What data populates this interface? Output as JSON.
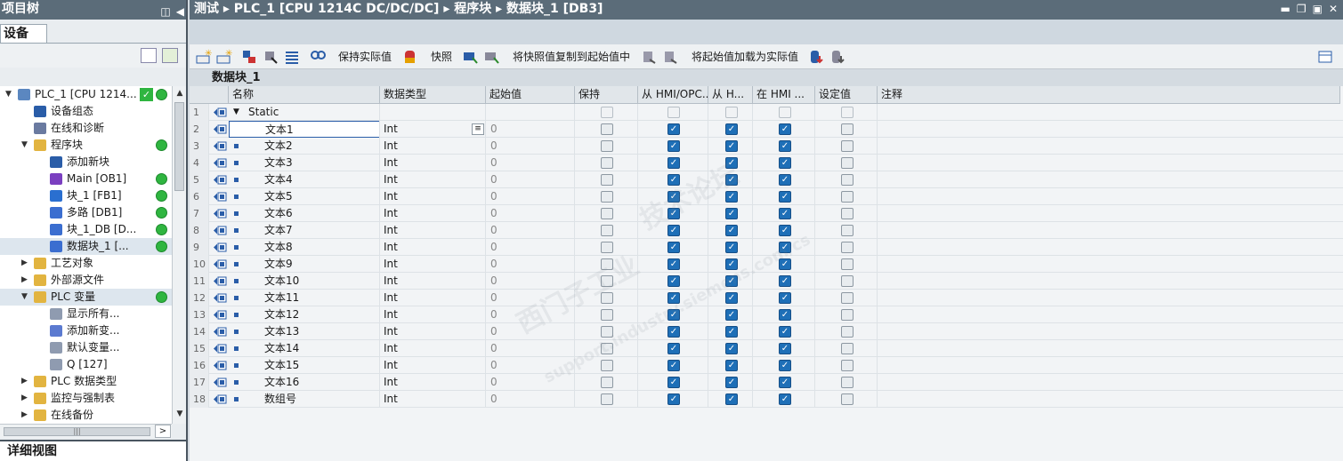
{
  "left_panel": {
    "title": "项目树",
    "tab": "设备",
    "detail_view": "详细视图",
    "tree": [
      {
        "label": "PLC_1 [CPU 1214...",
        "indent": 0,
        "expanded": true,
        "status": "check+green",
        "icon": "plc-icon"
      },
      {
        "label": "设备组态",
        "indent": 1,
        "icon": "device-config-icon"
      },
      {
        "label": "在线和诊断",
        "indent": 1,
        "icon": "online-diagnostics-icon"
      },
      {
        "label": "程序块",
        "indent": 1,
        "expanded": true,
        "status": "green",
        "icon": "folder-icon"
      },
      {
        "label": "添加新块",
        "indent": 2,
        "icon": "add-block-icon"
      },
      {
        "label": "Main [OB1]",
        "indent": 2,
        "status": "green",
        "icon": "ob-icon"
      },
      {
        "label": "块_1 [FB1]",
        "indent": 2,
        "status": "green",
        "icon": "fb-icon"
      },
      {
        "label": "多路 [DB1]",
        "indent": 2,
        "status": "green",
        "icon": "db-icon"
      },
      {
        "label": "块_1_DB [D...",
        "indent": 2,
        "status": "green",
        "icon": "db-icon"
      },
      {
        "label": "数据块_1 [...",
        "indent": 2,
        "status": "green",
        "icon": "db-icon",
        "selected": true
      },
      {
        "label": "工艺对象",
        "indent": 1,
        "collapsed": true,
        "icon": "folder-icon"
      },
      {
        "label": "外部源文件",
        "indent": 1,
        "collapsed": true,
        "icon": "folder-icon"
      },
      {
        "label": "PLC 变量",
        "indent": 1,
        "expanded": true,
        "status": "green",
        "icon": "folder-icon",
        "highlight": true
      },
      {
        "label": "显示所有...",
        "indent": 2,
        "icon": "tag-table-icon"
      },
      {
        "label": "添加新变...",
        "indent": 2,
        "icon": "add-tag-icon"
      },
      {
        "label": "默认变量...",
        "indent": 2,
        "icon": "tag-table-icon"
      },
      {
        "label": "Q [127]",
        "indent": 2,
        "icon": "tag-table-icon"
      },
      {
        "label": "PLC 数据类型",
        "indent": 1,
        "collapsed": true,
        "icon": "folder-icon"
      },
      {
        "label": "监控与强制表",
        "indent": 1,
        "collapsed": true,
        "icon": "folder-icon"
      },
      {
        "label": "在线备份",
        "indent": 1,
        "collapsed": true,
        "icon": "folder-icon"
      }
    ]
  },
  "breadcrumb": [
    "测试",
    "PLC_1 [CPU 1214C DC/DC/DC]",
    "程序块",
    "数据块_1 [DB3]"
  ],
  "toolbar": {
    "keep_actual": "保持实际值",
    "snapshot": "快照",
    "copy_snapshot": "将快照值复制到起始值中",
    "load_start": "将起始值加载为实际值"
  },
  "db_title": "数据块_1",
  "table": {
    "headers": [
      "名称",
      "数据类型",
      "起始值",
      "保持",
      "从 HMI/OPC...",
      "从 H...",
      "在 HMI ...",
      "设定值",
      "注释"
    ],
    "rows": [
      {
        "no": "1",
        "name": "Static",
        "type": "",
        "start": "",
        "retain": false,
        "hmi_opc": false,
        "from_h": false,
        "in_hmi": false,
        "setpoint": false,
        "static": true
      },
      {
        "no": "2",
        "name": "文本1",
        "type": "Int",
        "start": "0",
        "retain": false,
        "hmi_opc": true,
        "from_h": true,
        "in_hmi": true,
        "setpoint": false
      },
      {
        "no": "3",
        "name": "文本2",
        "type": "Int",
        "start": "0",
        "retain": false,
        "hmi_opc": true,
        "from_h": true,
        "in_hmi": true,
        "setpoint": false
      },
      {
        "no": "4",
        "name": "文本3",
        "type": "Int",
        "start": "0",
        "retain": false,
        "hmi_opc": true,
        "from_h": true,
        "in_hmi": true,
        "setpoint": false
      },
      {
        "no": "5",
        "name": "文本4",
        "type": "Int",
        "start": "0",
        "retain": false,
        "hmi_opc": true,
        "from_h": true,
        "in_hmi": true,
        "setpoint": false
      },
      {
        "no": "6",
        "name": "文本5",
        "type": "Int",
        "start": "0",
        "retain": false,
        "hmi_opc": true,
        "from_h": true,
        "in_hmi": true,
        "setpoint": false
      },
      {
        "no": "7",
        "name": "文本6",
        "type": "Int",
        "start": "0",
        "retain": false,
        "hmi_opc": true,
        "from_h": true,
        "in_hmi": true,
        "setpoint": false
      },
      {
        "no": "8",
        "name": "文本7",
        "type": "Int",
        "start": "0",
        "retain": false,
        "hmi_opc": true,
        "from_h": true,
        "in_hmi": true,
        "setpoint": false
      },
      {
        "no": "9",
        "name": "文本8",
        "type": "Int",
        "start": "0",
        "retain": false,
        "hmi_opc": true,
        "from_h": true,
        "in_hmi": true,
        "setpoint": false
      },
      {
        "no": "10",
        "name": "文本9",
        "type": "Int",
        "start": "0",
        "retain": false,
        "hmi_opc": true,
        "from_h": true,
        "in_hmi": true,
        "setpoint": false
      },
      {
        "no": "11",
        "name": "文本10",
        "type": "Int",
        "start": "0",
        "retain": false,
        "hmi_opc": true,
        "from_h": true,
        "in_hmi": true,
        "setpoint": false
      },
      {
        "no": "12",
        "name": "文本11",
        "type": "Int",
        "start": "0",
        "retain": false,
        "hmi_opc": true,
        "from_h": true,
        "in_hmi": true,
        "setpoint": false
      },
      {
        "no": "13",
        "name": "文本12",
        "type": "Int",
        "start": "0",
        "retain": false,
        "hmi_opc": true,
        "from_h": true,
        "in_hmi": true,
        "setpoint": false
      },
      {
        "no": "14",
        "name": "文本13",
        "type": "Int",
        "start": "0",
        "retain": false,
        "hmi_opc": true,
        "from_h": true,
        "in_hmi": true,
        "setpoint": false
      },
      {
        "no": "15",
        "name": "文本14",
        "type": "Int",
        "start": "0",
        "retain": false,
        "hmi_opc": true,
        "from_h": true,
        "in_hmi": true,
        "setpoint": false
      },
      {
        "no": "16",
        "name": "文本15",
        "type": "Int",
        "start": "0",
        "retain": false,
        "hmi_opc": true,
        "from_h": true,
        "in_hmi": true,
        "setpoint": false
      },
      {
        "no": "17",
        "name": "文本16",
        "type": "Int",
        "start": "0",
        "retain": false,
        "hmi_opc": true,
        "from_h": true,
        "in_hmi": true,
        "setpoint": false
      },
      {
        "no": "18",
        "name": "数组号",
        "type": "Int",
        "start": "0",
        "retain": false,
        "hmi_opc": true,
        "from_h": true,
        "in_hmi": true,
        "setpoint": false
      }
    ]
  },
  "watermark": [
    "西门子工业",
    "技术论坛",
    "support.industry.siemens.com/cs"
  ],
  "colors": {
    "title_bar": "#5b6c79",
    "status_ok": "#2fb540",
    "checkbox_on": "#1e6fb7"
  }
}
